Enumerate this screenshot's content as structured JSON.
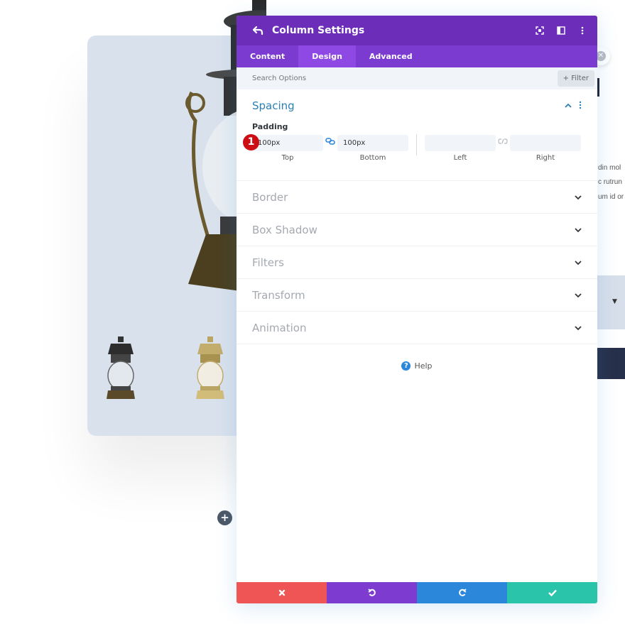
{
  "modal": {
    "title": "Column Settings",
    "tabs": [
      {
        "label": "Content",
        "active": false
      },
      {
        "label": "Design",
        "active": true
      },
      {
        "label": "Advanced",
        "active": false
      }
    ],
    "search": {
      "placeholder": "Search Options",
      "filter_label": "+ Filter"
    },
    "spacing": {
      "title": "Spacing",
      "padding_label": "Padding",
      "badge": "1",
      "fields": [
        {
          "caption": "Top",
          "value": "100px"
        },
        {
          "caption": "Bottom",
          "value": "100px"
        },
        {
          "caption": "Left",
          "value": ""
        },
        {
          "caption": "Right",
          "value": ""
        }
      ]
    },
    "sections": [
      {
        "title": "Border"
      },
      {
        "title": "Box Shadow"
      },
      {
        "title": "Filters"
      },
      {
        "title": "Transform"
      },
      {
        "title": "Animation"
      }
    ],
    "help_label": "Help",
    "footer": {
      "cancel_color": "#ef5555",
      "undo_color": "#7e3bd0",
      "redo_color": "#2b87da",
      "save_color": "#29c4a9"
    }
  },
  "background": {
    "text_lines": [
      "din mol",
      "c rutrun",
      "um id or"
    ],
    "select_arrow": "▼",
    "add_label": "+"
  },
  "colors": {
    "header": "#6c2eb9",
    "tabs": "#7b3ad0",
    "active_tab": "#8e48e4",
    "accent": "#2b7fb5",
    "badge": "#cc0d14"
  }
}
